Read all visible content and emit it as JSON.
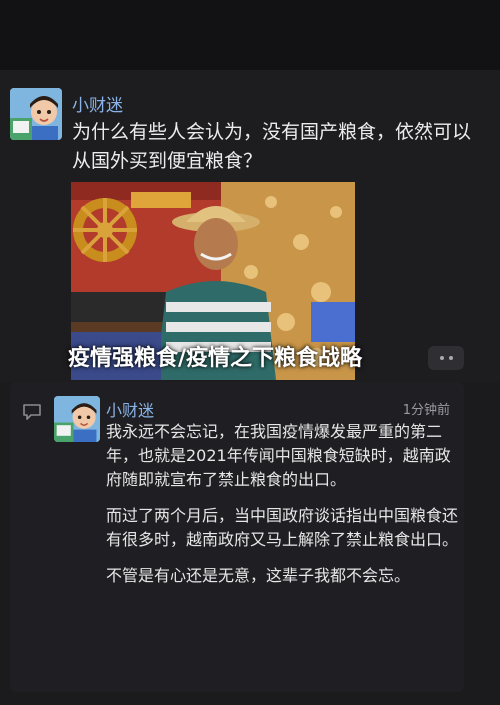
{
  "post": {
    "author": "小财迷",
    "question": "为什么有些人会认为，没有国产粮食，依然可以从国外买到便宜粮食？"
  },
  "headline": "疫情强粮食/疫情之下粮食战略",
  "comment": {
    "author": "小财迷",
    "time": "1分钟前",
    "paragraphs": [
      "我永远不会忘记，在我国疫情爆发最严重的第二年，也就是2021年传闻中国粮食短缺时，越南政府随即就宣布了禁止粮食的出口。",
      "而过了两个月后，当中国政府谈话指出中国粮食还有很多时，越南政府又马上解除了禁止粮食出口。",
      "不管是有心还是无意，这辈子我都不会忘。"
    ]
  },
  "icons": {
    "more": "more-dots-icon",
    "comment": "comment-bubble-icon"
  },
  "colors": {
    "background": "#1b1b1e",
    "author_name": "#8ab4e8",
    "body_text": "#e6e6e7",
    "muted": "#9a9aa0"
  }
}
